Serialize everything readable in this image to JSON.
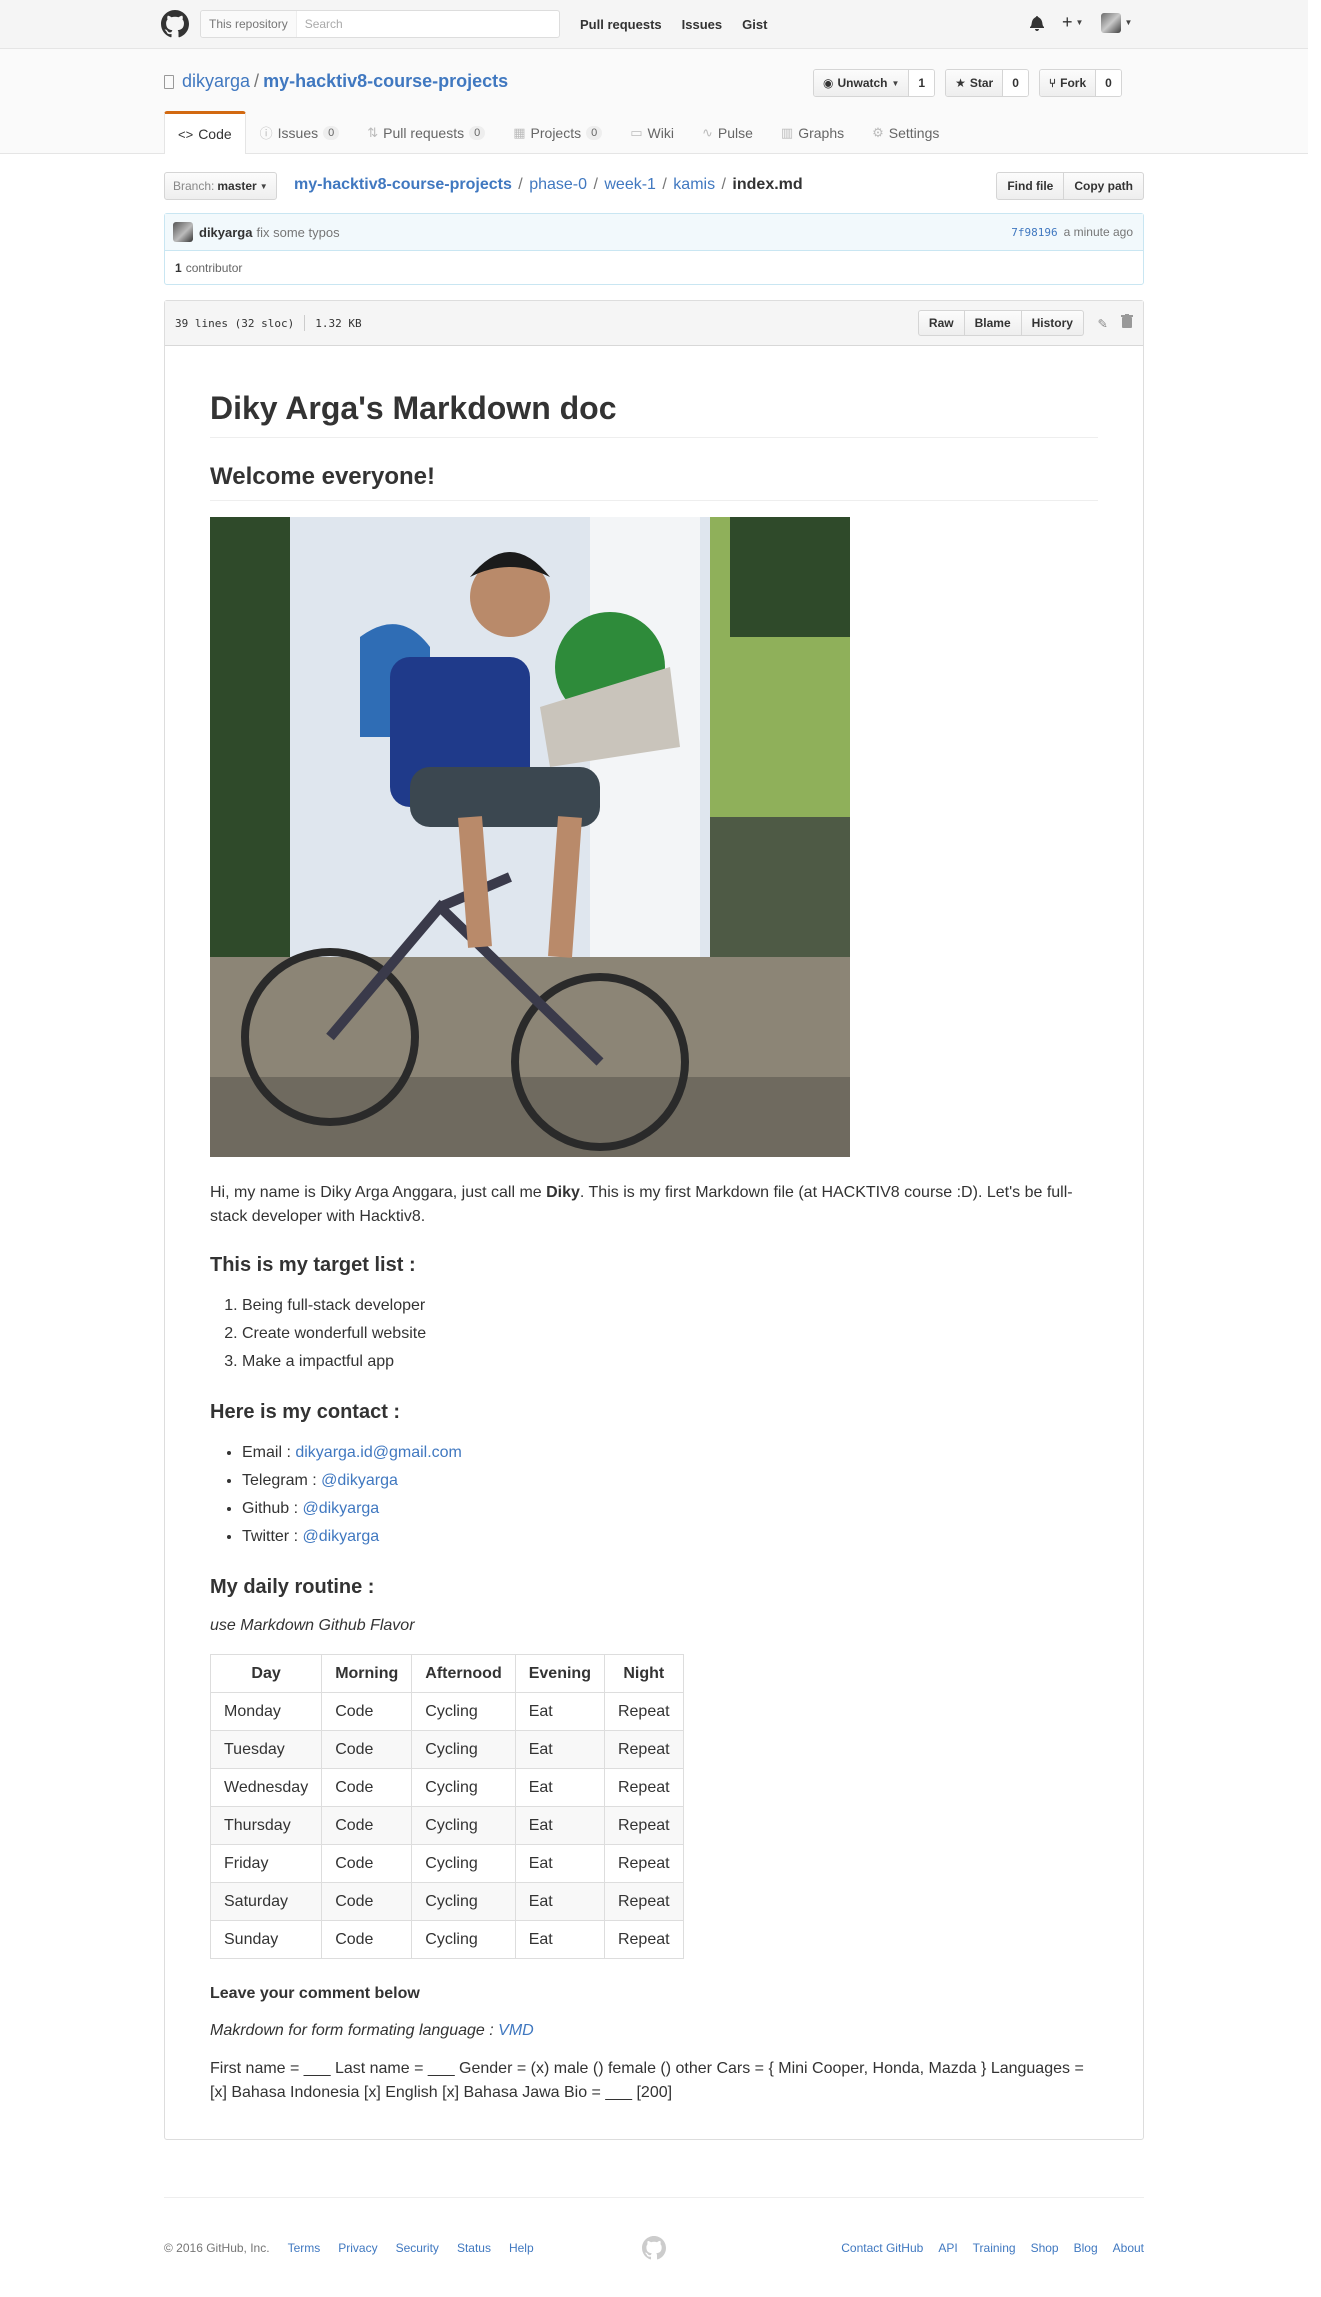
{
  "header": {
    "search_scope": "This repository",
    "search_placeholder": "Search",
    "nav": [
      "Pull requests",
      "Issues",
      "Gist"
    ]
  },
  "repo": {
    "owner": "dikyarga",
    "name": "my-hacktiv8-course-projects",
    "actions": {
      "watch_label": "Unwatch",
      "watch_count": "1",
      "star_label": "Star",
      "star_count": "0",
      "fork_label": "Fork",
      "fork_count": "0"
    },
    "tabs": [
      {
        "label": "Code",
        "count": null,
        "icon": "code-icon"
      },
      {
        "label": "Issues",
        "count": "0",
        "icon": "issue-icon"
      },
      {
        "label": "Pull requests",
        "count": "0",
        "icon": "pull-request-icon"
      },
      {
        "label": "Projects",
        "count": "0",
        "icon": "project-icon"
      },
      {
        "label": "Wiki",
        "count": null,
        "icon": "book-icon"
      },
      {
        "label": "Pulse",
        "count": null,
        "icon": "pulse-icon"
      },
      {
        "label": "Graphs",
        "count": null,
        "icon": "graph-icon"
      },
      {
        "label": "Settings",
        "count": null,
        "icon": "gear-icon"
      }
    ]
  },
  "file_nav": {
    "branch_label": "Branch:",
    "branch": "master",
    "path_root": "my-hacktiv8-course-projects",
    "path": [
      "phase-0",
      "week-1",
      "kamis"
    ],
    "file": "index.md",
    "find_file": "Find file",
    "copy_path": "Copy path"
  },
  "commit": {
    "author": "dikyarga",
    "message": "fix some typos",
    "sha": "7f98196",
    "time": "a minute ago",
    "contributors_count": "1",
    "contributors_label": "contributor"
  },
  "file": {
    "lines": "39 lines (32 sloc)",
    "size": "1.32 KB",
    "raw": "Raw",
    "blame": "Blame",
    "history": "History"
  },
  "doc": {
    "h1": "Diky Arga's Markdown doc",
    "h2": "Welcome everyone!",
    "intro_before": "Hi, my name is Diky Arga Anggara, just call me ",
    "intro_bold": "Diky",
    "intro_after": ". This is my first Markdown file (at HACKTIV8 course :D). Let's be full-stack developer with Hacktiv8.",
    "targets_heading": "This is my target list :",
    "targets": [
      "Being full-stack developer",
      "Create wonderfull website",
      "Make a impactful app"
    ],
    "contact_heading": "Here is my contact :",
    "contacts": [
      {
        "label": "Email : ",
        "value": "dikyarga.id@gmail.com"
      },
      {
        "label": "Telegram : ",
        "value": "@dikyarga"
      },
      {
        "label": "Github : ",
        "value": "@dikyarga"
      },
      {
        "label": "Twitter : ",
        "value": "@dikyarga"
      }
    ],
    "routine_heading": "My daily routine :",
    "routine_note": "use Markdown Github Flavor",
    "table": {
      "headers": [
        "Day",
        "Morning",
        "Afternood",
        "Evening",
        "Night"
      ],
      "rows": [
        [
          "Monday",
          "Code",
          "Cycling",
          "Eat",
          "Repeat"
        ],
        [
          "Tuesday",
          "Code",
          "Cycling",
          "Eat",
          "Repeat"
        ],
        [
          "Wednesday",
          "Code",
          "Cycling",
          "Eat",
          "Repeat"
        ],
        [
          "Thursday",
          "Code",
          "Cycling",
          "Eat",
          "Repeat"
        ],
        [
          "Friday",
          "Code",
          "Cycling",
          "Eat",
          "Repeat"
        ],
        [
          "Saturday",
          "Code",
          "Cycling",
          "Eat",
          "Repeat"
        ],
        [
          "Sunday",
          "Code",
          "Cycling",
          "Eat",
          "Repeat"
        ]
      ]
    },
    "comment_heading": "Leave your comment below",
    "vmd_text": "Makrdown for form formating language : ",
    "vmd_link": "VMD",
    "form_text": "First name = ___ Last name = ___ Gender = (x) male () female () other Cars = { Mini Cooper, Honda, Mazda } Languages = [x] Bahasa Indonesia [x] English [x] Bahasa Jawa Bio = ___ [200]"
  },
  "footer": {
    "copyright": "© 2016 GitHub, Inc.",
    "left_links": [
      "Terms",
      "Privacy",
      "Security",
      "Status",
      "Help"
    ],
    "right_links": [
      "Contact GitHub",
      "API",
      "Training",
      "Shop",
      "Blog",
      "About"
    ]
  },
  "colors": {
    "link": "#4078c0",
    "tab_accent": "#d26911",
    "commit_border": "#c9e6f2"
  }
}
